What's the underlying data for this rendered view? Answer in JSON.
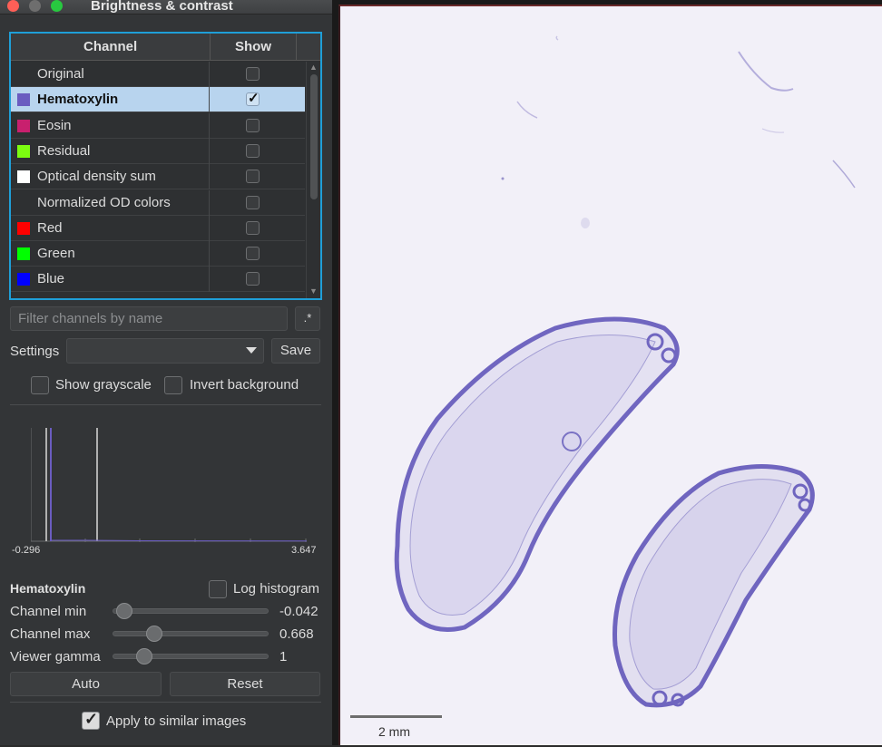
{
  "window": {
    "title": "Brightness & contrast"
  },
  "table": {
    "headers": {
      "channel": "Channel",
      "show": "Show"
    },
    "rows": [
      {
        "label": "Original",
        "color": null,
        "checked": false,
        "selected": false
      },
      {
        "label": "Hematoxylin",
        "color": "#6a5cc0",
        "checked": true,
        "selected": true
      },
      {
        "label": "Eosin",
        "color": "#c8206e",
        "checked": false,
        "selected": false
      },
      {
        "label": "Residual",
        "color": "#7cfc10",
        "checked": false,
        "selected": false
      },
      {
        "label": "Optical density sum",
        "color": "#ffffff",
        "checked": false,
        "selected": false
      },
      {
        "label": "Normalized OD colors",
        "color": null,
        "checked": false,
        "selected": false
      },
      {
        "label": "Red",
        "color": "#ff0000",
        "checked": false,
        "selected": false
      },
      {
        "label": "Green",
        "color": "#00ff00",
        "checked": false,
        "selected": false
      },
      {
        "label": "Blue",
        "color": "#0000ff",
        "checked": false,
        "selected": false
      }
    ]
  },
  "filter": {
    "placeholder": "Filter channels by name",
    "regex_label": ".*"
  },
  "settings": {
    "label": "Settings",
    "value": "",
    "save_label": "Save"
  },
  "options": {
    "show_grayscale": "Show grayscale",
    "invert_background": "Invert background"
  },
  "histogram": {
    "min_label": "-0.296",
    "max_label": "3.647"
  },
  "controls": {
    "channel_name": "Hematoxylin",
    "log_histogram": "Log histogram",
    "channel_min": {
      "label": "Channel min",
      "value": "-0.042",
      "fraction": 0.07
    },
    "channel_max": {
      "label": "Channel max",
      "value": "0.668",
      "fraction": 0.26
    },
    "viewer_gamma": {
      "label": "Viewer gamma",
      "value": "1",
      "fraction": 0.2
    },
    "auto_label": "Auto",
    "reset_label": "Reset",
    "apply_similar": "Apply to similar images"
  },
  "viewer": {
    "scale_label": "2 mm"
  }
}
